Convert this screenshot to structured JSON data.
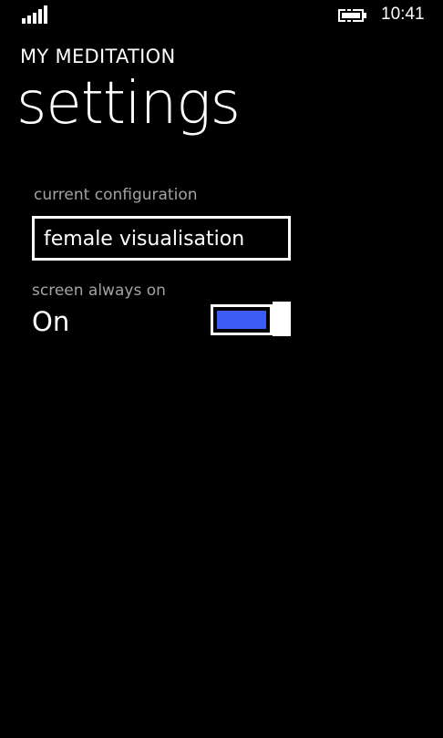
{
  "status_bar": {
    "time": "10:41",
    "signal_icon": "signal-strength-icon",
    "battery_icon": "battery-charging-icon"
  },
  "app": {
    "title": "MY MEDITATION"
  },
  "page": {
    "title": "settings"
  },
  "settings": {
    "configuration": {
      "label": "current configuration",
      "value": "female visualisation"
    },
    "screen_always_on": {
      "label": "screen always on",
      "state_text": "On",
      "enabled": true
    }
  },
  "colors": {
    "background": "#000000",
    "foreground": "#ffffff",
    "label": "#a3a3a3",
    "accent": "#3d5cf5"
  }
}
